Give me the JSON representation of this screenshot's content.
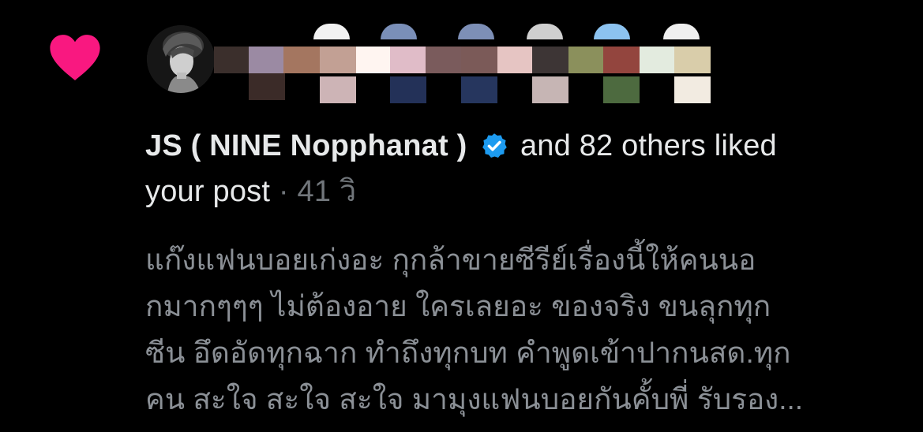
{
  "notification": {
    "user_name": "JS ( NINE Nopphanat )",
    "action_text": "and 82 others liked",
    "action_text_cont": "your post",
    "separator": "·",
    "time": "41 วิ",
    "post_lines": [
      "แก๊งแฟนบอยเก่งอะ กุกล้าขายซีรีย์เรื่องนี้ให้คนนอ",
      "กมากๆๆๆ ไม่ต้องอาย ใครเลยอะ ของจริง ขนลุกทุก",
      "ซีน อึดอัดทุกฉาก ทำถึงทุกบท คำพูดเข้าปากนสด.ทุก",
      "คน สะใจ สะใจ สะใจ มามุงแฟนบอยกันคั้บพี่ รับรอง..."
    ]
  },
  "colors": {
    "background": "#000000",
    "heart": "#f91880",
    "verified": "#1d9bf0",
    "primary_text": "#e7e9ea",
    "secondary_text": "#71767b"
  },
  "icons": {
    "like": "heart-icon",
    "verified": "verified-badge-icon"
  }
}
